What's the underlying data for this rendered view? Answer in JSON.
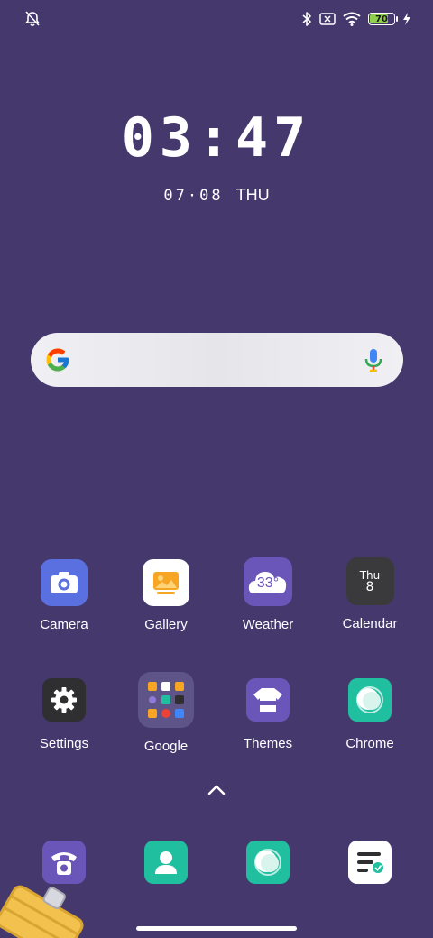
{
  "status_bar": {
    "left_icon": "notifications-off-icon",
    "right_icons": [
      "bluetooth-icon",
      "no-sim-icon",
      "wifi-icon"
    ],
    "battery_level": "70",
    "charging_icon": "bolt-icon"
  },
  "lockclock": {
    "time": "03:47",
    "date": "07·08",
    "weekday": "THU"
  },
  "search_bar": {
    "logo": "google-g-icon",
    "mic": "mic-icon"
  },
  "apps_row1": [
    {
      "label": "Camera",
      "icon": "camera-icon"
    },
    {
      "label": "Gallery",
      "icon": "gallery-icon"
    },
    {
      "label": "Weather",
      "icon": "weather-icon",
      "temp": "33°"
    },
    {
      "label": "Calendar",
      "icon": "calendar-icon",
      "day_abbr": "Thu",
      "day_num": "8"
    }
  ],
  "apps_row2": [
    {
      "label": "Settings",
      "icon": "gear-icon"
    },
    {
      "label": "Google",
      "icon": "folder-icon"
    },
    {
      "label": "Themes",
      "icon": "themes-icon"
    },
    {
      "label": "Chrome",
      "icon": "chrome-icon"
    }
  ],
  "dock": [
    {
      "icon": "phone-icon"
    },
    {
      "icon": "contacts-icon"
    },
    {
      "icon": "browser-icon"
    },
    {
      "icon": "notes-icon"
    }
  ],
  "drawer_handle": "chevron-up-icon",
  "colors": {
    "background": "#45386d",
    "camera": "#5a6fe0",
    "gallery": "#ffffff",
    "weather": "#6a55b8",
    "calendar": "#3a3a3c",
    "settings": "#2f2f32",
    "themes": "#6a55b8",
    "chrome": "#1fbfa0",
    "battery_fill": "#8fd14f"
  }
}
